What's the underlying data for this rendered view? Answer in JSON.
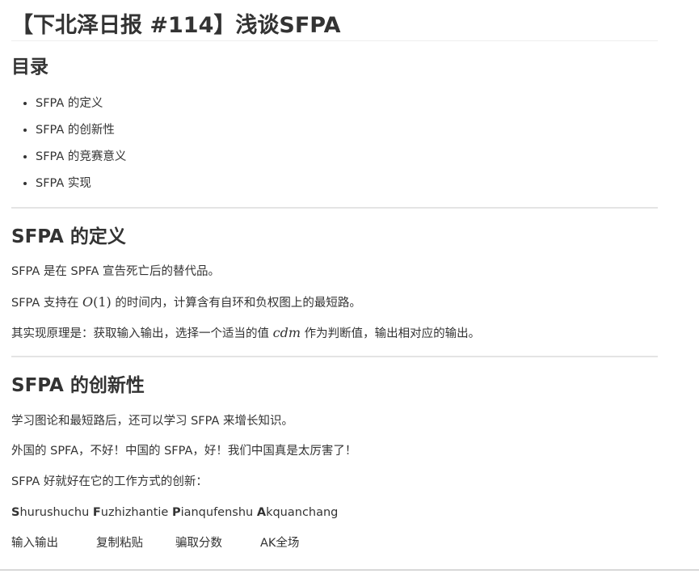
{
  "title": "【下北泽日报 #114】浅谈SFPA",
  "toc": {
    "heading": "目录",
    "items": [
      "SFPA 的定义",
      "SFPA 的创新性",
      "SFPA 的竞赛意义",
      "SFPA 实现"
    ]
  },
  "sections": {
    "definition": {
      "heading": "SFPA 的定义",
      "p1": "SFPA 是在 SPFA 宣告死亡后的替代品。",
      "p2_before": "SFPA 支持在 ",
      "p2_math_o": "O",
      "p2_math_arg": "(1)",
      "p2_after": " 的时间内，计算含有自环和负权图上的最短路。",
      "p3_before": "其实现原理是：获取输入输出，选择一个适当的值 ",
      "p3_math": "cdm",
      "p3_after": " 作为判断值，输出相对应的输出。"
    },
    "innovation": {
      "heading": "SFPA 的创新性",
      "p1": "学习图论和最短路后，还可以学习 SFPA 来增长知识。",
      "p2": "外国的 SPFA，不好！中国的 SFPA，好！我们中国真是太厉害了！",
      "p3": "SFPA 好就好在它的工作方式的创新：",
      "acronym": [
        {
          "initial": "S",
          "rest": "hurushuchu"
        },
        {
          "initial": "F",
          "rest": "uzhizhantie"
        },
        {
          "initial": "P",
          "rest": "ianqufenshu"
        },
        {
          "initial": "A",
          "rest": "kquanchang"
        }
      ],
      "meanings": [
        "输入输出",
        "复制粘贴",
        "骗取分数",
        "AK全场"
      ]
    }
  }
}
